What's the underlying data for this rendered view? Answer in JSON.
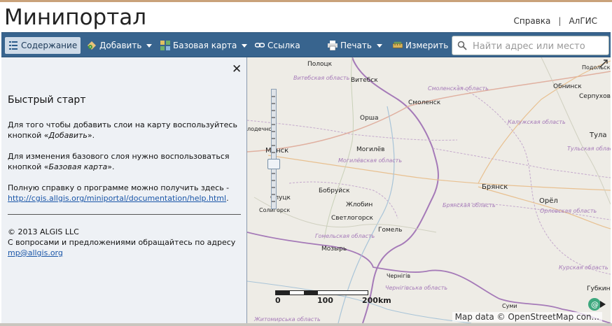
{
  "header": {
    "title": "Минипортал",
    "links": [
      "Справка",
      "АлГИС"
    ]
  },
  "toolbar": {
    "contents": "Содержание",
    "add": "Добавить",
    "basemap": "Базовая карта",
    "link": "Ссылка",
    "print": "Печать",
    "measure": "Измерить",
    "search_placeholder": "Найти адрес или место"
  },
  "sidebar": {
    "title": "Быстрый старт",
    "p1_a": "Для того чтобы добавить слои на карту воспользуйтесь кнопкой «",
    "p1_em": "Добавить",
    "p1_b": "».",
    "p2_a": "Для изменения базового слоя нужно воспользоваться кнопкой «",
    "p2_em": "Базовая карта",
    "p2_b": "».",
    "p3": "Полную справку о программе можно получить здесь -",
    "help_url": "http://cgis.allgis.org/miniportal/documentation/help.html",
    "p3_end": ".",
    "copyright": "© 2013 ALGIS LLC",
    "contact": "С вопросами и предложениями обращайтесь по адресу",
    "email": "mp@allgis.org"
  },
  "map": {
    "labels": {
      "polotsk": "Полоцк",
      "vitebsk_obl": "Витебская область",
      "vitebsk": "Витебск",
      "smolensk_obl": "Смоленская область",
      "smolensk": "Смоленск",
      "obninsk": "Обнинск",
      "serpukhov": "Серпухов",
      "podolsk": "Подольск",
      "orsha": "Орша",
      "kaluga_obl": "Калужская область",
      "tula": "Тула",
      "tula_obl": "Тульская область",
      "molodechno": "лодечно",
      "minsk": "Минск",
      "mogilev": "Могилёв",
      "mogilev_obl": "Могилёвская область",
      "bryansk": "Брянск",
      "bobruisk": "Бобруйск",
      "oryol": "Орёл",
      "slutsk": "Слуцк",
      "zhlobin": "Жлобин",
      "bryansk_obl": "Брянская область",
      "orel_obl": "Орловская область",
      "soligorsk": "Солигорск",
      "svetlogorsk": "Светлогорск",
      "gomel": "Гомель",
      "gomel_obl": "Гомельская область",
      "mozyr": "Мозырь",
      "chernihiv": "Чернігів",
      "chernihiv_obl": "Чернігівська область",
      "kursk_obl": "Курская область",
      "gubkin": "Губкин",
      "sumy": "Суми",
      "zhytomyr_obl": "Житомирська область"
    },
    "scale": [
      "0",
      "100",
      "200km"
    ],
    "attribution": "Map data © OpenStreetMap con..."
  },
  "colors": {
    "toolbar": "#38648e",
    "sidebar_bg": "#eef1f5",
    "border": "#a57ab8",
    "link": "#1a56a8"
  }
}
